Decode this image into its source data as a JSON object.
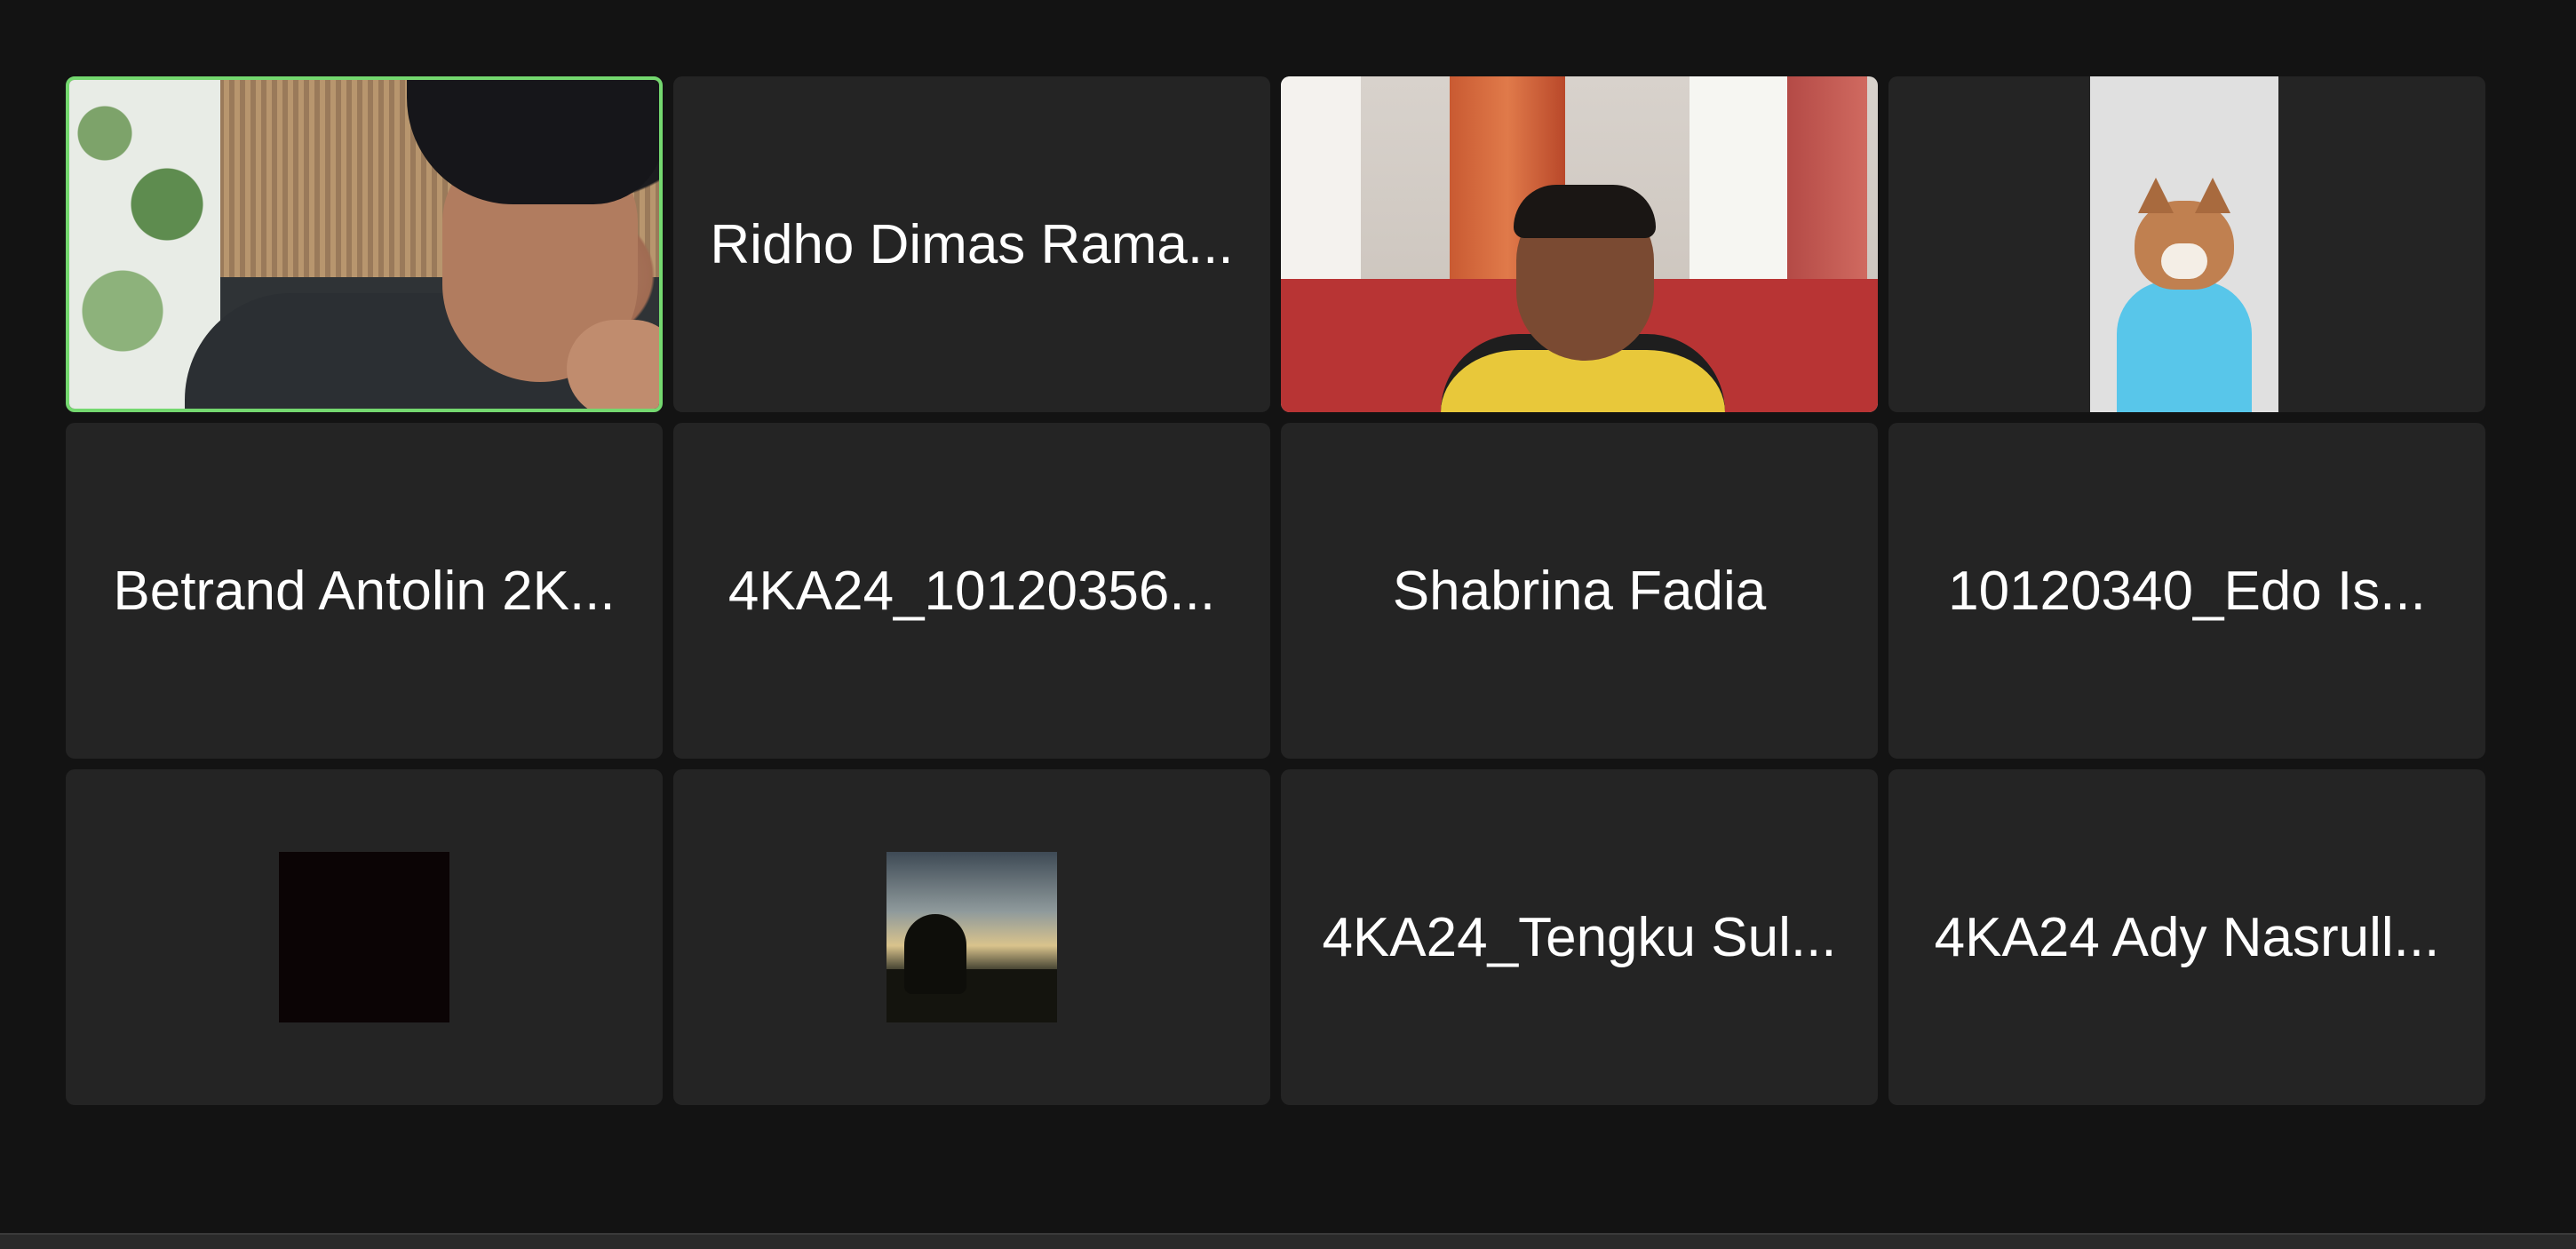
{
  "tiles": [
    {
      "type": "video",
      "video": "man-on-terrace",
      "active": true
    },
    {
      "type": "name",
      "name": "Ridho Dimas Rama..."
    },
    {
      "type": "video",
      "video": "man-in-red-room"
    },
    {
      "type": "avatar",
      "avatar": "cat-avatar"
    },
    {
      "type": "name",
      "name": "Betrand Antolin 2K..."
    },
    {
      "type": "name",
      "name": "4KA24_10120356..."
    },
    {
      "type": "name",
      "name": "Shabrina Fadia"
    },
    {
      "type": "name",
      "name": "10120340_Edo Is..."
    },
    {
      "type": "thumbnail",
      "thumbnail": "dark"
    },
    {
      "type": "thumbnail",
      "thumbnail": "sunset-silhouette"
    },
    {
      "type": "name",
      "name": "4KA24_Tengku Sul..."
    },
    {
      "type": "name",
      "name": "4KA24 Ady Nasrull..."
    }
  ],
  "colors": {
    "background": "#131313",
    "tile": "#242424",
    "active_speaker_border": "#74d86f",
    "name_text": "#ffffff"
  }
}
